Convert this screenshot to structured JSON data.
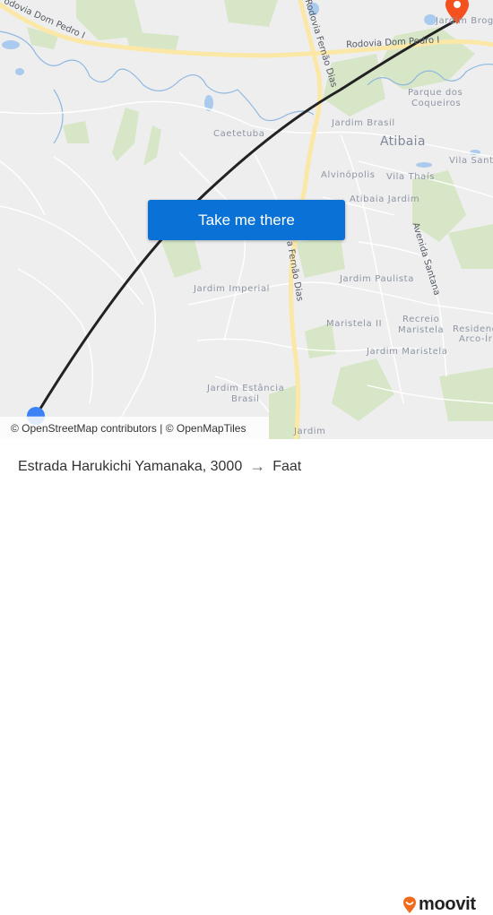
{
  "map": {
    "place_labels": [
      {
        "id": "caetetuba",
        "text": "Caetetuba"
      },
      {
        "id": "jardim-brasil",
        "text": "Jardim Brasil"
      },
      {
        "id": "atibaia",
        "text": "Atibaia"
      },
      {
        "id": "parque-dos-coqueiros-1",
        "text": "Parque dos"
      },
      {
        "id": "parque-dos-coqueiros-2",
        "text": "Coqueiros"
      },
      {
        "id": "vila-santista",
        "text": "Vila Santi"
      },
      {
        "id": "alvinopolis",
        "text": "Alvinópolis"
      },
      {
        "id": "vila-thais",
        "text": "Vila Thaís"
      },
      {
        "id": "atibaia-jardim",
        "text": "Atibaia Jardim"
      },
      {
        "id": "jardim-imperial",
        "text": "Jardim Imperial"
      },
      {
        "id": "jardim-paulista",
        "text": "Jardim Paulista"
      },
      {
        "id": "maristela-ii",
        "text": "Maristela II"
      },
      {
        "id": "recreio-maristela-1",
        "text": "Recreio"
      },
      {
        "id": "recreio-maristela-2",
        "text": "Maristela"
      },
      {
        "id": "residencial-1",
        "text": "Residenc"
      },
      {
        "id": "residencial-2",
        "text": "Arco-Ír"
      },
      {
        "id": "jardim-maristela",
        "text": "Jardim Maristela"
      },
      {
        "id": "jardim-estancia-1",
        "text": "Jardim Estância"
      },
      {
        "id": "jardim-estancia-2",
        "text": "Brasil"
      },
      {
        "id": "jardim-bottom",
        "text": "Jardim"
      },
      {
        "id": "jardim-brog",
        "text": "Jardim Brog"
      }
    ],
    "road_labels": {
      "dom_pedro_west": "odovia Dom Pedro I",
      "dom_pedro_east": "Rodovia Dom Pedro I",
      "fernao_dias_north": "Rodovia Fernão Dias",
      "fernao_dias_south": "a Fernão Dias",
      "avenida_santana": "Avenida Santana"
    },
    "origin_color": "#3b82f6",
    "destination_color": "#f4511e",
    "route_color": "#222222"
  },
  "cta": {
    "label": "Take me there",
    "color": "#0a72d6"
  },
  "attribution": "© OpenStreetMap contributors | © OpenMapTiles",
  "footer": {
    "origin": "Estrada Harukichi Yamanaka, 3000",
    "arrow": "→",
    "destination": "Faat",
    "brand": "moovit",
    "brand_color": "#f26a1b"
  }
}
